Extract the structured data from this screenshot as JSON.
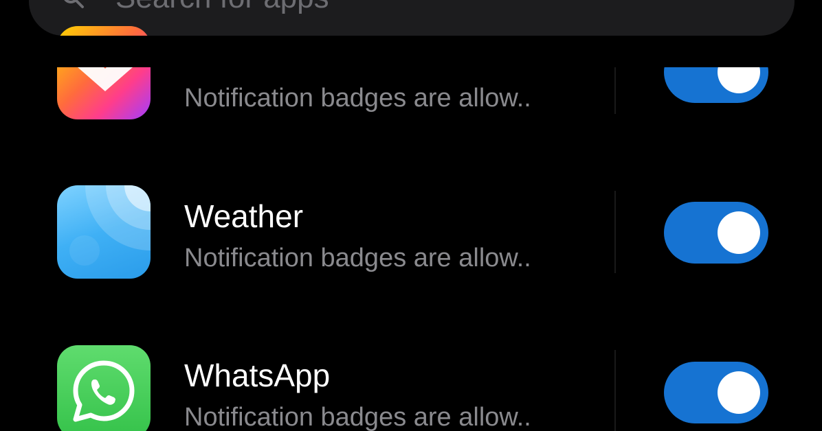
{
  "search": {
    "placeholder": "Search for apps",
    "icon": "search-icon"
  },
  "apps": [
    {
      "name": "",
      "description": "Notification badges are allow..",
      "icon": "gallery-icon",
      "toggle_on": true
    },
    {
      "name": "Weather",
      "description": "Notification badges are allow..",
      "icon": "weather-icon",
      "toggle_on": true
    },
    {
      "name": "WhatsApp",
      "description": "Notification badges are allow..",
      "icon": "whatsapp-icon",
      "toggle_on": true
    }
  ],
  "colors": {
    "background": "#000000",
    "toggle_on": "#1673d2",
    "primary_text": "#ffffff",
    "secondary_text": "#8a8a8e"
  }
}
